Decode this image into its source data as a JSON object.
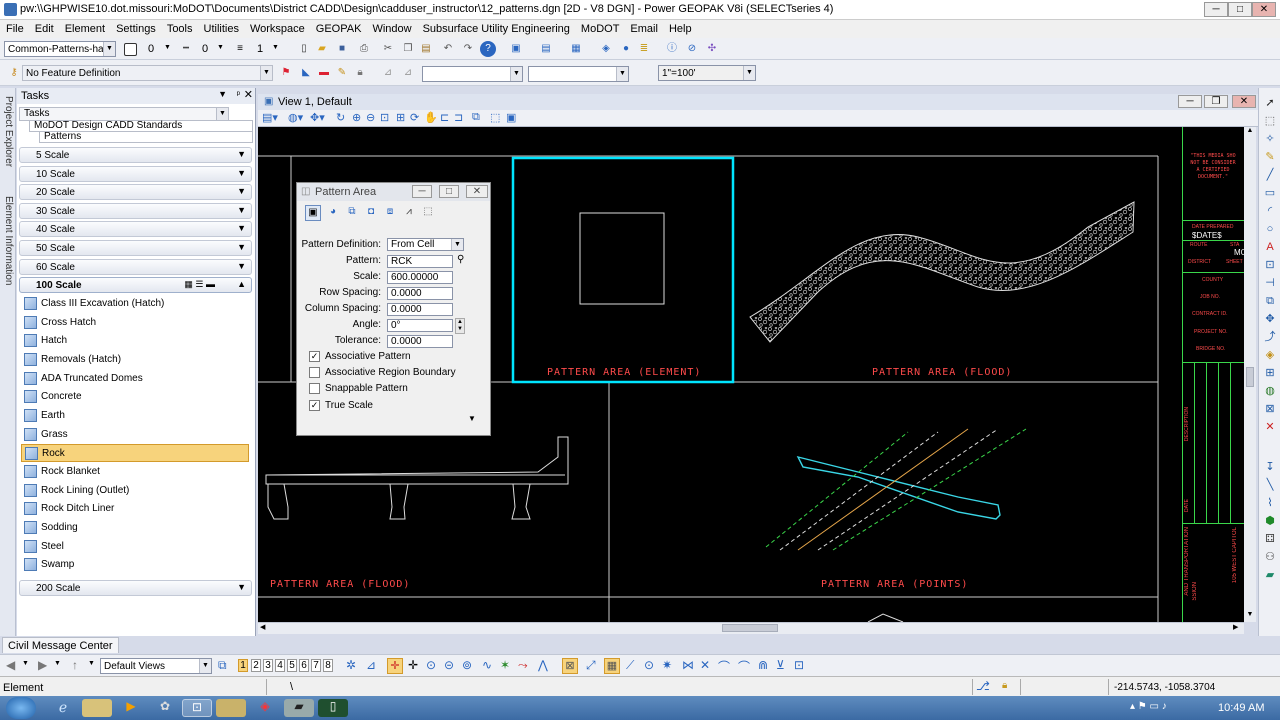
{
  "window": {
    "title": "pw:\\\\GHPWISE10.dot.missouri:MoDOT\\Documents\\District CADD\\Design\\cadduser_instructor\\12_patterns.dgn [2D - V8 DGN] - Power GEOPAK V8i (SELECTseries 4)"
  },
  "menu": [
    "File",
    "Edit",
    "Element",
    "Settings",
    "Tools",
    "Utilities",
    "Workspace",
    "GEOPAK",
    "Window",
    "Subsurface Utility Engineering",
    "MoDOT",
    "Email",
    "Help"
  ],
  "attr": {
    "level": "Common-Patterns-hatc",
    "color": "0",
    "style": "0",
    "weight": "1"
  },
  "feature": {
    "label": "No Feature Definition",
    "scale": "1\"=100'"
  },
  "tasks": {
    "title": "Tasks",
    "dropdown": "Tasks",
    "crumb1": "MoDOT Design CADD Standards",
    "crumb2": "Patterns",
    "scales_top": [
      "5 Scale",
      "10 Scale",
      "20 Scale",
      "30 Scale",
      "40 Scale",
      "50 Scale",
      "60 Scale"
    ],
    "active_scale": "100 Scale",
    "items": [
      "Class III Excavation (Hatch)",
      "Cross Hatch",
      "Hatch",
      "Removals (Hatch)",
      "ADA Truncated Domes",
      "Concrete",
      "Earth",
      "Grass",
      "Rock",
      "Rock Blanket",
      "Rock Lining (Outlet)",
      "Rock Ditch Liner",
      "Sodding",
      "Steel",
      "Swamp"
    ],
    "selected": "Rock",
    "scale_bottom": "200 Scale"
  },
  "sidetabs": {
    "a": "Project Explorer",
    "b": "Element Information"
  },
  "view": {
    "title": "View 1, Default"
  },
  "canvas_labels": {
    "elem": "PATTERN AREA (ELEMENT)",
    "flood1": "PATTERN AREA (FLOOD)",
    "flood2": "PATTERN AREA (FLOOD)",
    "points": "PATTERN AREA (POINTS)"
  },
  "sheet": {
    "note1": "\"THIS MEDIA SHO",
    "note2": "NOT BE CONSIDER",
    "note3": "A CERTIFIED",
    "note4": "DOCUMENT.\"",
    "date_prepared": "DATE PREPARED",
    "dates": "$DATE$",
    "route": "ROUTE",
    "sta": "STA",
    "district": "DISTRICT",
    "sheet": "SHEET",
    "mo": "MO",
    "county": "COUNTY",
    "job": "JOB NO.",
    "contract": "CONTRACT ID.",
    "project": "PROJECT NO.",
    "bridge": "BRIDGE NO.",
    "description": "DESCRIPTION",
    "date": "DATE",
    "dept": "AND TRANSPORTATION",
    "commission": "SSION",
    "capitol": "105 WEST CAPITOL"
  },
  "dialog": {
    "title": "Pattern Area",
    "definition_label": "Pattern Definition:",
    "definition": "From Cell",
    "pattern_label": "Pattern:",
    "pattern": "RCK",
    "scale_label": "Scale:",
    "scale": "600.00000",
    "row_label": "Row Spacing:",
    "row": "0.0000",
    "col_label": "Column Spacing:",
    "col": "0.0000",
    "angle_label": "Angle:",
    "angle": "0°",
    "tol_label": "Tolerance:",
    "tol": "0.0000",
    "checks": [
      {
        "label": "Associative Pattern",
        "on": "✓"
      },
      {
        "label": "Associative Region Boundary",
        "on": ""
      },
      {
        "label": "Snappable Pattern",
        "on": ""
      },
      {
        "label": "True Scale",
        "on": "✓"
      }
    ]
  },
  "bottom": {
    "tab": "Civil Message Center",
    "views": "Default Views",
    "numbers": [
      "1",
      "2",
      "3",
      "4",
      "5",
      "6",
      "7",
      "8"
    ]
  },
  "status": {
    "left": "Element",
    "prompt": "\\",
    "coords": "-214.5743, -1058.3704"
  },
  "taskbar": {
    "time": "10:49 AM"
  },
  "colors": {
    "selection": "#00e5ff",
    "cad_red": "#ff4b4b",
    "selected_item": "#f7d37c"
  }
}
